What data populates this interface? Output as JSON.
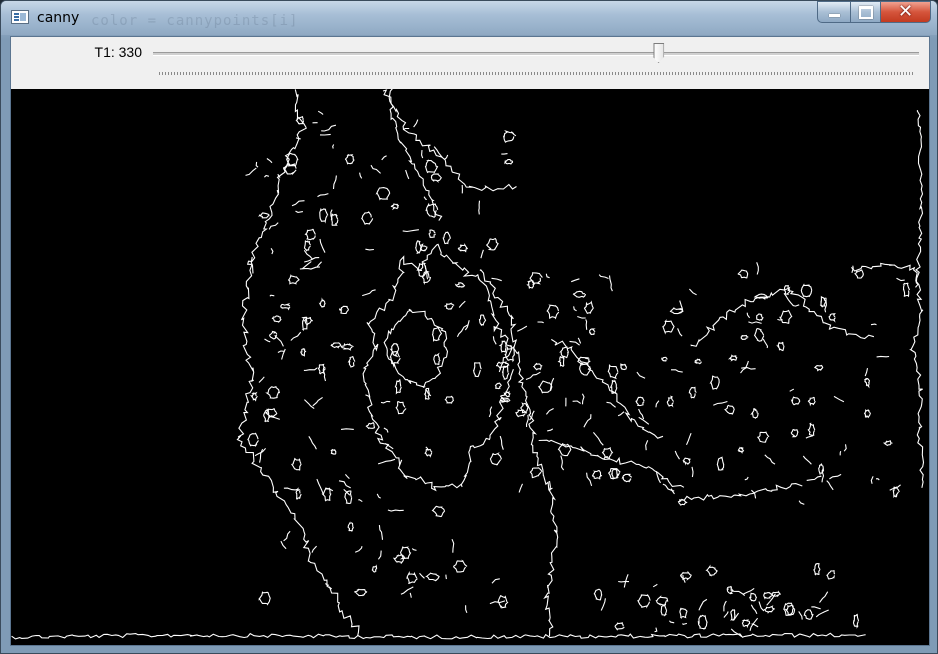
{
  "window": {
    "title": "canny",
    "ghost_code": "color = cannypoints[i]",
    "icons": {
      "app": "app-window-icon",
      "minimize": "minimize-icon",
      "maximize": "maximize-icon",
      "close": "close-icon"
    },
    "colors": {
      "close_button": "#c23a20",
      "titlebar": "#a7bed6"
    }
  },
  "trackbar": {
    "label": "T1: 330",
    "value": 330,
    "max": 500
  },
  "image": {
    "description": "Canny edge detection output",
    "background": "#000000",
    "edge_color": "#ffffff"
  }
}
